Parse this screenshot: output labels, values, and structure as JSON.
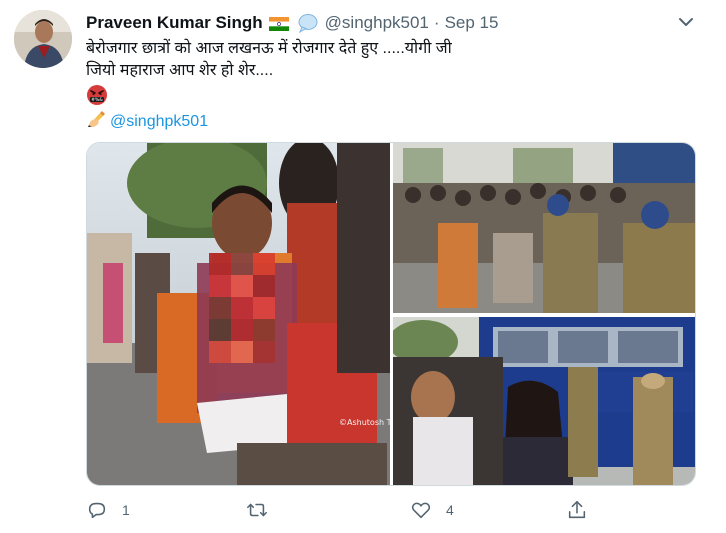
{
  "tweet": {
    "author_name": "Praveen Kumar Singh",
    "handle": "@singhpk501",
    "separator": "·",
    "date": "Sep 15",
    "text_line_1": "बेरोजगार छात्रों को आज लखनऊ में रोजगार देते हुए .....योगी जी",
    "text_line_2": "जियो महाराज आप शेर हो शेर....",
    "mention": "@singhpk501",
    "emoji_badge_text": "#%&",
    "photo_credit": "©Ashutosh Tripa"
  },
  "actions": {
    "reply_count": "1",
    "retweet_count": "",
    "like_count": "4"
  },
  "icons": {
    "flag": "india-flag-icon",
    "badge": "speech-bubble-icon",
    "caret": "chevron-down-icon",
    "emoji": "cursing-face-icon",
    "writing": "writing-hand-icon",
    "reply": "reply-icon",
    "retweet": "retweet-icon",
    "like": "heart-icon",
    "share": "share-icon"
  },
  "colors": {
    "link": "#1b95e0",
    "muted": "#536471",
    "text": "#0f1419",
    "border": "#cfd9de",
    "police_bus": "#1d3c8e"
  }
}
